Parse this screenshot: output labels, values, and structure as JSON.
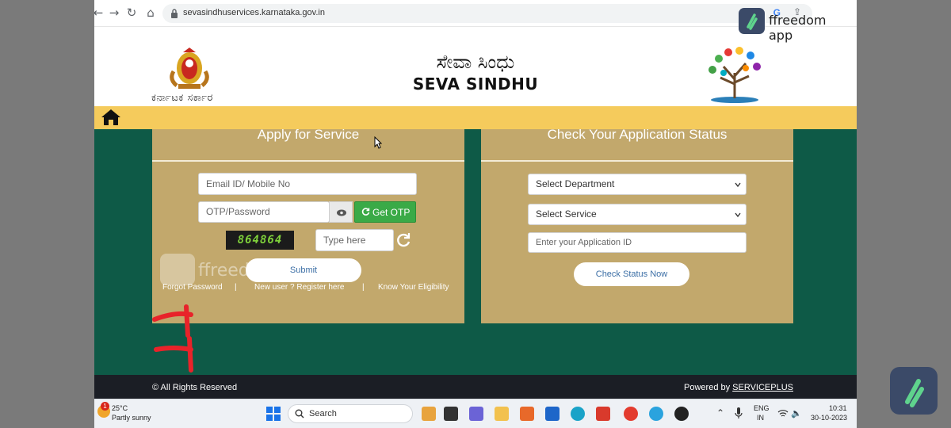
{
  "browser": {
    "url": "sevasindhuservices.karnataka.gov.in",
    "google_icon": "G"
  },
  "header": {
    "emblem_caption": "ಕರ್ನಾಟಕ ಸರ್ಕಾರ",
    "title_kannada": "ಸೇವಾ ಸಿಂಧು",
    "title_english": "SEVA SINDHU",
    "logo_text": "ಸೇವಾ ಸಿಂಧು"
  },
  "nav": {
    "home_icon": "home-icon"
  },
  "apply_panel": {
    "title": "Apply for Service",
    "email_placeholder": "Email ID/ Mobile No",
    "otp_placeholder": "OTP/Password",
    "get_otp_label": "Get OTP",
    "captcha_text": "864864",
    "captcha_placeholder": "Type here",
    "submit_label": "Submit",
    "links": [
      "Forgot Password",
      "New user ? Register here",
      "Know Your Eligibility"
    ],
    "separator": "|"
  },
  "status_panel": {
    "title": "Check Your Application Status",
    "department_select": "Select Department",
    "service_select": "Select Service",
    "application_id_placeholder": "Enter your Application ID",
    "check_label": "Check Status Now"
  },
  "footer": {
    "copyright": "© All Rights Reserved",
    "powered_prefix": "Powered by ",
    "powered_link": "SERVICEPLUS"
  },
  "taskbar": {
    "weather_badge": "1",
    "weather_temp": "25°C",
    "weather_desc": "Partly sunny",
    "search_label": "Search",
    "lang_top": "ENG",
    "lang_bottom": "IN",
    "time": "10:31",
    "date": "30-10-2023"
  },
  "overlay": {
    "brand_text": "ffreedom app",
    "watermark_text": "ffreedom app"
  },
  "colors": {
    "nav_yellow": "#f5cb5c",
    "main_green": "#0e5a47",
    "panel_tan": "#c2a86c",
    "otp_green": "#3aaa47",
    "footer_dark": "#1b1e25",
    "annotation_red": "#e8232a"
  }
}
